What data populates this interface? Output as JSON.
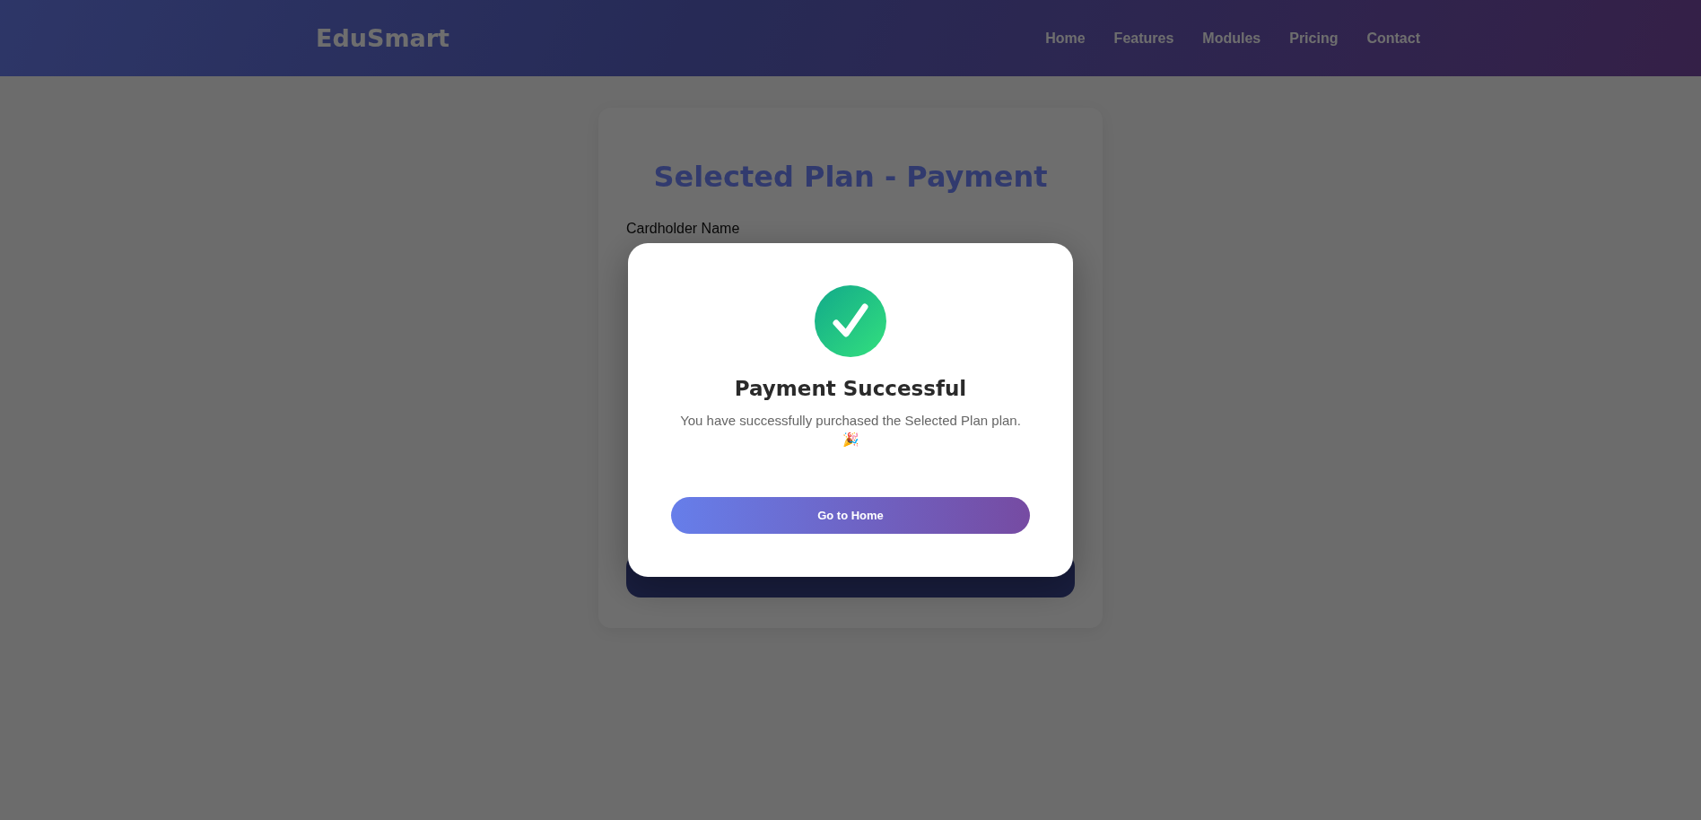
{
  "header": {
    "logo": "EduSmart",
    "nav": [
      {
        "label": "Home"
      },
      {
        "label": "Features"
      },
      {
        "label": "Modules"
      },
      {
        "label": "Pricing"
      },
      {
        "label": "Contact"
      }
    ]
  },
  "payment_form": {
    "title": "Selected Plan - Payment",
    "fields": [
      {
        "label": "Cardholder Name"
      }
    ]
  },
  "modal": {
    "title": "Payment Successful",
    "message": "You have successfully purchased the Selected Plan plan. 🎉",
    "button": "Go to Home"
  }
}
